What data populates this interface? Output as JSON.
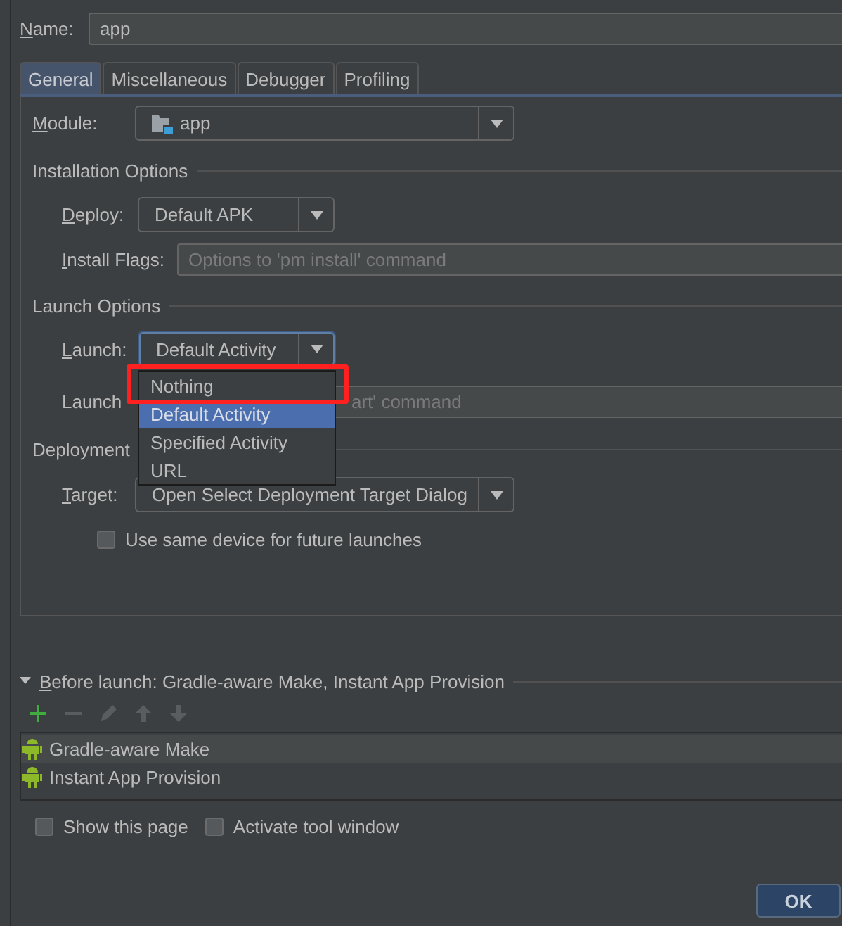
{
  "name_field": {
    "label": "Name:",
    "mnemonic": true,
    "value": "app"
  },
  "tabs": [
    {
      "label": "General",
      "selected": true
    },
    {
      "label": "Miscellaneous",
      "selected": false
    },
    {
      "label": "Debugger",
      "selected": false
    },
    {
      "label": "Profiling",
      "selected": false
    }
  ],
  "module": {
    "label": "Module:",
    "mnemonic": true,
    "value": "app"
  },
  "installation_options": {
    "title": "Installation Options",
    "deploy": {
      "label": "Deploy:",
      "mnemonic": true,
      "value": "Default APK"
    },
    "install_flags": {
      "label": "Install Flags:",
      "mnemonic": true,
      "placeholder": "Options to 'pm install' command"
    }
  },
  "launch_options": {
    "title": "Launch Options",
    "launch": {
      "label": "Launch:",
      "mnemonic": true,
      "value": "Default Activity",
      "focused": true
    },
    "launch_flags": {
      "label": "Launch",
      "placeholder": "art' command"
    }
  },
  "launch_dropdown": {
    "items": [
      {
        "label": "Nothing",
        "selected": false,
        "highlighted": true
      },
      {
        "label": "Default Activity",
        "selected": true,
        "highlighted": false
      },
      {
        "label": "Specified Activity",
        "selected": false,
        "highlighted": false
      },
      {
        "label": "URL",
        "selected": false,
        "highlighted": false
      }
    ]
  },
  "deployment_target": {
    "title": "Deployment",
    "target": {
      "label": "Target:",
      "mnemonic": true,
      "value": "Open Select Deployment Target Dialog"
    },
    "same_device": {
      "label": "Use same device for future launches",
      "checked": false
    }
  },
  "before_launch": {
    "title": "Before launch: Gradle-aware Make, Instant App Provision",
    "mnemonic": true,
    "expanded": true,
    "toolbar": [
      {
        "kind": "add",
        "disabled": false
      },
      {
        "kind": "remove",
        "disabled": true
      },
      {
        "kind": "edit",
        "disabled": true
      },
      {
        "kind": "up",
        "disabled": true
      },
      {
        "kind": "down",
        "disabled": true
      }
    ],
    "tasks": [
      {
        "label": "Gradle-aware Make",
        "selected": true
      },
      {
        "label": "Instant App Provision",
        "selected": false
      }
    ]
  },
  "options": [
    {
      "label": "Show this page",
      "checked": false
    },
    {
      "label": "Activate tool window",
      "checked": false
    }
  ],
  "buttons": [
    {
      "label": "OK",
      "default": true
    }
  ]
}
